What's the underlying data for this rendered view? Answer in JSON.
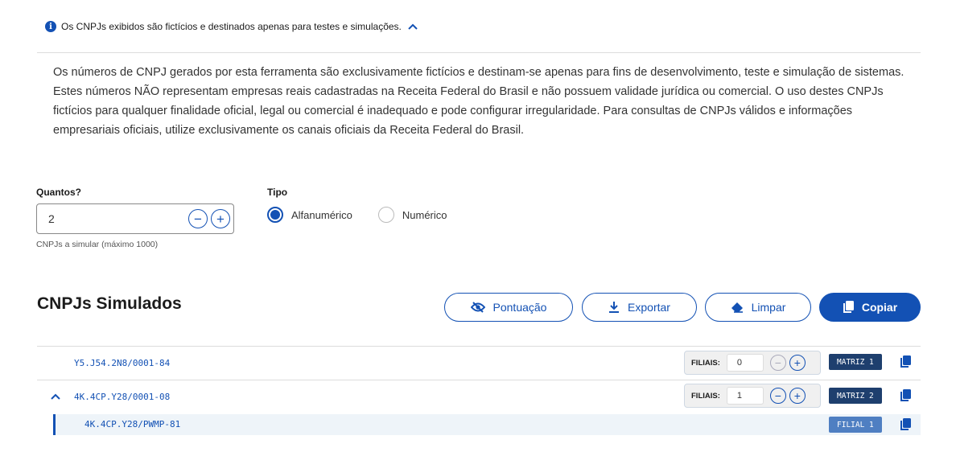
{
  "notice": {
    "text": "Os CNPJs exibidos são fictícios e destinados apenas para testes e simulações.",
    "info_icon": "i"
  },
  "disclaimer": "Os números de CNPJ gerados por esta ferramenta são exclusivamente fictícios e destinam-se apenas para fins de desenvolvimento, teste e simulação de sistemas. Estes números NÃO representam empresas reais cadastradas na Receita Federal do Brasil e não possuem validade jurídica ou comercial. O uso destes CNPJs fictícios para qualquer finalidade oficial, legal ou comercial é inadequado e pode configurar irregularidade. Para consultas de CNPJs válidos e informações empresariais oficiais, utilize exclusivamente os canais oficiais da Receita Federal do Brasil.",
  "form": {
    "quantity_label": "Quantos?",
    "quantity_value": "2",
    "quantity_help": "CNPJs a simular (máximo 1000)",
    "minus": "−",
    "plus": "+",
    "type_label": "Tipo",
    "type_options": [
      "Alfanumérico",
      "Numérico"
    ],
    "type_selected": "Alfanumérico"
  },
  "results": {
    "title": "CNPJs Simulados",
    "buttons": {
      "score": "Pontuação",
      "export": "Exportar",
      "clear": "Limpar",
      "copy": "Copiar"
    },
    "filiais_label": "FILIAIS:",
    "rows": [
      {
        "cnpj": "Y5.J54.2N8/0001-84",
        "filiais": "0",
        "tag": "MATRIZ 1"
      },
      {
        "cnpj": "4K.4CP.Y28/0001-08",
        "filiais": "1",
        "tag": "MATRIZ 2"
      }
    ],
    "branch": {
      "cnpj": "4K.4CP.Y28/PWMP-81",
      "tag": "FILIAL 1"
    }
  },
  "colors": {
    "primary": "#1351b4",
    "tag_matriz": "#1e3f6e",
    "tag_filial": "#4f7fc2"
  }
}
